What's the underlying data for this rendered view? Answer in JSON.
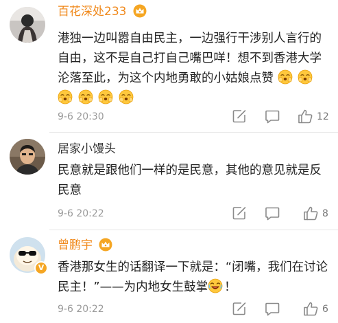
{
  "comments": [
    {
      "username": "百花深处233",
      "name_color": "orange",
      "has_crown": true,
      "text": "港独一边叫嚣自由民主，一边强行干涉别人言行的自由，这不是自己打自己嘴巴咩！想不到香港大学沦落至此，为这个内地勇敢的小姑娘点赞",
      "emoji_count": 6,
      "time": "9-6 20:30",
      "likes": "12"
    },
    {
      "username": "居家小馒头",
      "name_color": "gray",
      "has_crown": false,
      "text": "民意就是跟他们一样的是民意，其他的意见就是反民意",
      "time": "9-6 20:22",
      "likes": "8"
    },
    {
      "username": "曾鹏宇",
      "name_color": "orange",
      "has_crown": true,
      "verified": true,
      "text_part1": "香港那女生的话翻译一下就是：“闭嘴，我们在讨论民主！”——为内地女生鼓掌",
      "text_part2": "！",
      "time": "9-6 20:22",
      "likes": "6"
    }
  ],
  "icons": {
    "crown": "crown-badge-icon",
    "emoji": "clapping-face-icon",
    "share": "share-edit-icon",
    "reply": "comment-icon",
    "like": "thumbs-up-icon",
    "laugh": "laughing-face-icon"
  },
  "colors": {
    "username_highlight": "#f0881a",
    "meta_gray": "#9a9a9a",
    "text": "#222222"
  }
}
